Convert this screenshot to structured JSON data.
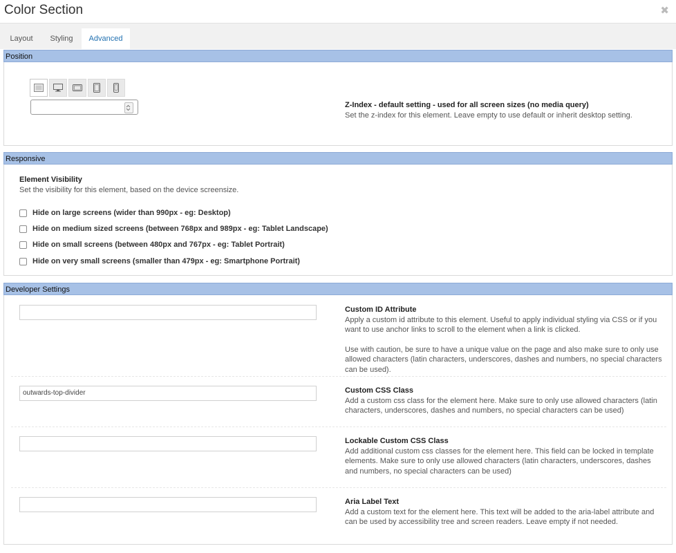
{
  "window": {
    "title": "Color Section",
    "close_glyph": "✖"
  },
  "tabs": [
    {
      "label": "Layout",
      "active": false
    },
    {
      "label": "Styling",
      "active": false
    },
    {
      "label": "Advanced",
      "active": true
    }
  ],
  "position": {
    "heading": "Position",
    "device_icons": [
      "all-screens-icon",
      "desktop-icon",
      "tablet-landscape-icon",
      "tablet-portrait-icon",
      "smartphone-icon"
    ],
    "zindex_value": "",
    "title": "Z-Index - default setting - used for all screen sizes (no media query)",
    "text": "Set the z-index for this element. Leave empty to use default or inherit desktop setting."
  },
  "responsive": {
    "heading": "Responsive",
    "title": "Element Visibility",
    "text": "Set the visibility for this element, based on the device screensize.",
    "options": [
      "Hide on large screens (wider than 990px - eg: Desktop)",
      "Hide on medium sized screens (between 768px and 989px - eg: Tablet Landscape)",
      "Hide on small screens (between 480px and 767px - eg: Tablet Portrait)",
      "Hide on very small screens (smaller than 479px - eg: Smartphone Portrait)"
    ]
  },
  "developer": {
    "heading": "Developer Settings",
    "custom_id": {
      "value": "",
      "title": "Custom ID Attribute",
      "text1": "Apply a custom id attribute to this element. Useful to apply individual styling via CSS or if you want to use anchor links to scroll to the element when a link is clicked.",
      "text2": "Use with caution, be sure to have a unique value on the page and also make sure to only use allowed characters (latin characters, underscores, dashes and numbers, no special characters can be used)."
    },
    "custom_class": {
      "value": "outwards-top-divider",
      "title": "Custom CSS Class",
      "text": "Add a custom css class for the element here. Make sure to only use allowed characters (latin characters, underscores, dashes and numbers, no special characters can be used)"
    },
    "lockable_class": {
      "value": "",
      "title": "Lockable Custom CSS Class",
      "text": "Add additional custom css classes for the element here. This field can be locked in template elements. Make sure to only use allowed characters (latin characters, underscores, dashes and numbers, no special characters can be used)"
    },
    "aria_label": {
      "value": "",
      "title": "Aria Label Text",
      "text": "Add a custom text for the element here. This text will be added to the aria-label attribute and can be used by accessibility tree and screen readers. Leave empty if not needed."
    }
  }
}
